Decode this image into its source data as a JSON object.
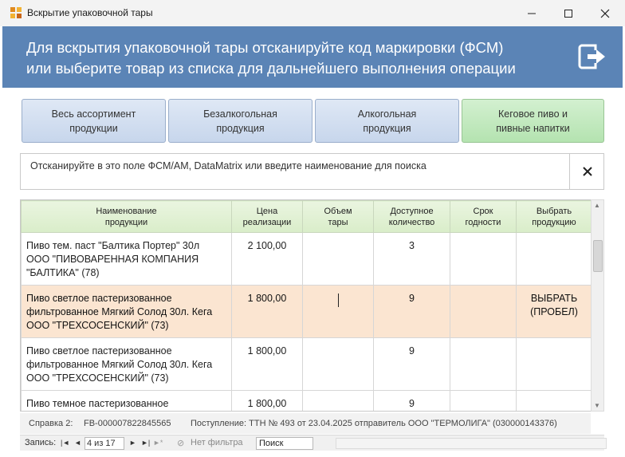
{
  "window": {
    "title": "Вскрытие упаковочной тары"
  },
  "header": {
    "line1": "Для вскрытия упаковочной тары отсканируйте код маркировки (ФСМ)",
    "line2": "или выберите товар из списка для дальнейшего выполнения операции"
  },
  "categories": [
    {
      "line1": "Весь ассортимент",
      "line2": "продукции"
    },
    {
      "line1": "Безалкогольная",
      "line2": "продукция"
    },
    {
      "line1": "Алкогольная",
      "line2": "продукция"
    },
    {
      "line1": "Кеговое пиво и",
      "line2": "пивные напитки"
    }
  ],
  "search": {
    "placeholder": "Отсканируйте в это поле ФСМ/АМ, DataMatrix или введите наименование для поиска"
  },
  "table": {
    "headers": [
      {
        "line1": "Наименование",
        "line2": "продукции"
      },
      {
        "line1": "Цена",
        "line2": "реализации"
      },
      {
        "line1": "Объем",
        "line2": "тары"
      },
      {
        "line1": "Доступное",
        "line2": "количество"
      },
      {
        "line1": "Срок",
        "line2": "годности"
      },
      {
        "line1": "Выбрать",
        "line2": "продукцию"
      }
    ],
    "rows": [
      {
        "name1": "Пиво тем. паст \"Балтика Портер\" 30л",
        "name2": "ООО \"ПИВОВАРЕННАЯ КОМПАНИЯ",
        "name3": "\"БАЛТИКА\" (78)",
        "price": "2 100,00",
        "volume": "",
        "qty": "3",
        "expiry": "",
        "select1": "",
        "select2": ""
      },
      {
        "name1": "Пиво светлое пастеризованное",
        "name2": "фильтрованное Мягкий Солод 30л. Кега",
        "name3": " ООО \"ТРЕХСОСЕНСКИЙ\" (73)",
        "price": "1 800,00",
        "volume": "",
        "qty": "9",
        "expiry": "",
        "select1": "ВЫБРАТЬ",
        "select2": "(ПРОБЕЛ)"
      },
      {
        "name1": "Пиво светлое пастеризованное",
        "name2": "фильтрованное Мягкий Солод 30л. Кега",
        "name3": " ООО \"ТРЕХСОСЕНСКИЙ\" (73)",
        "price": "1 800,00",
        "volume": "",
        "qty": "9",
        "expiry": "",
        "select1": "",
        "select2": ""
      },
      {
        "name1": "Пиво темное пастеризованное",
        "name2": "",
        "name3": "",
        "price": "1 800,00",
        "volume": "",
        "qty": "9",
        "expiry": "",
        "select1": "",
        "select2": ""
      }
    ]
  },
  "info": {
    "label": "Справка 2:",
    "code": "FB-000007822845565",
    "receipt": "Поступление: ТТН № 493 от 23.04.2025 отправитель ООО \"ТЕРМОЛИГА\" (030000143376)"
  },
  "navigator": {
    "label": "Запись:",
    "position": "4 из 17",
    "filter": "Нет фильтра",
    "search": "Поиск"
  },
  "colors": {
    "header_bg": "#5b84b6",
    "category_blue": "#c7d6ec",
    "category_green": "#b4e3b0",
    "selected_row": "#fbe5d1",
    "table_header": "#d9edc9"
  }
}
